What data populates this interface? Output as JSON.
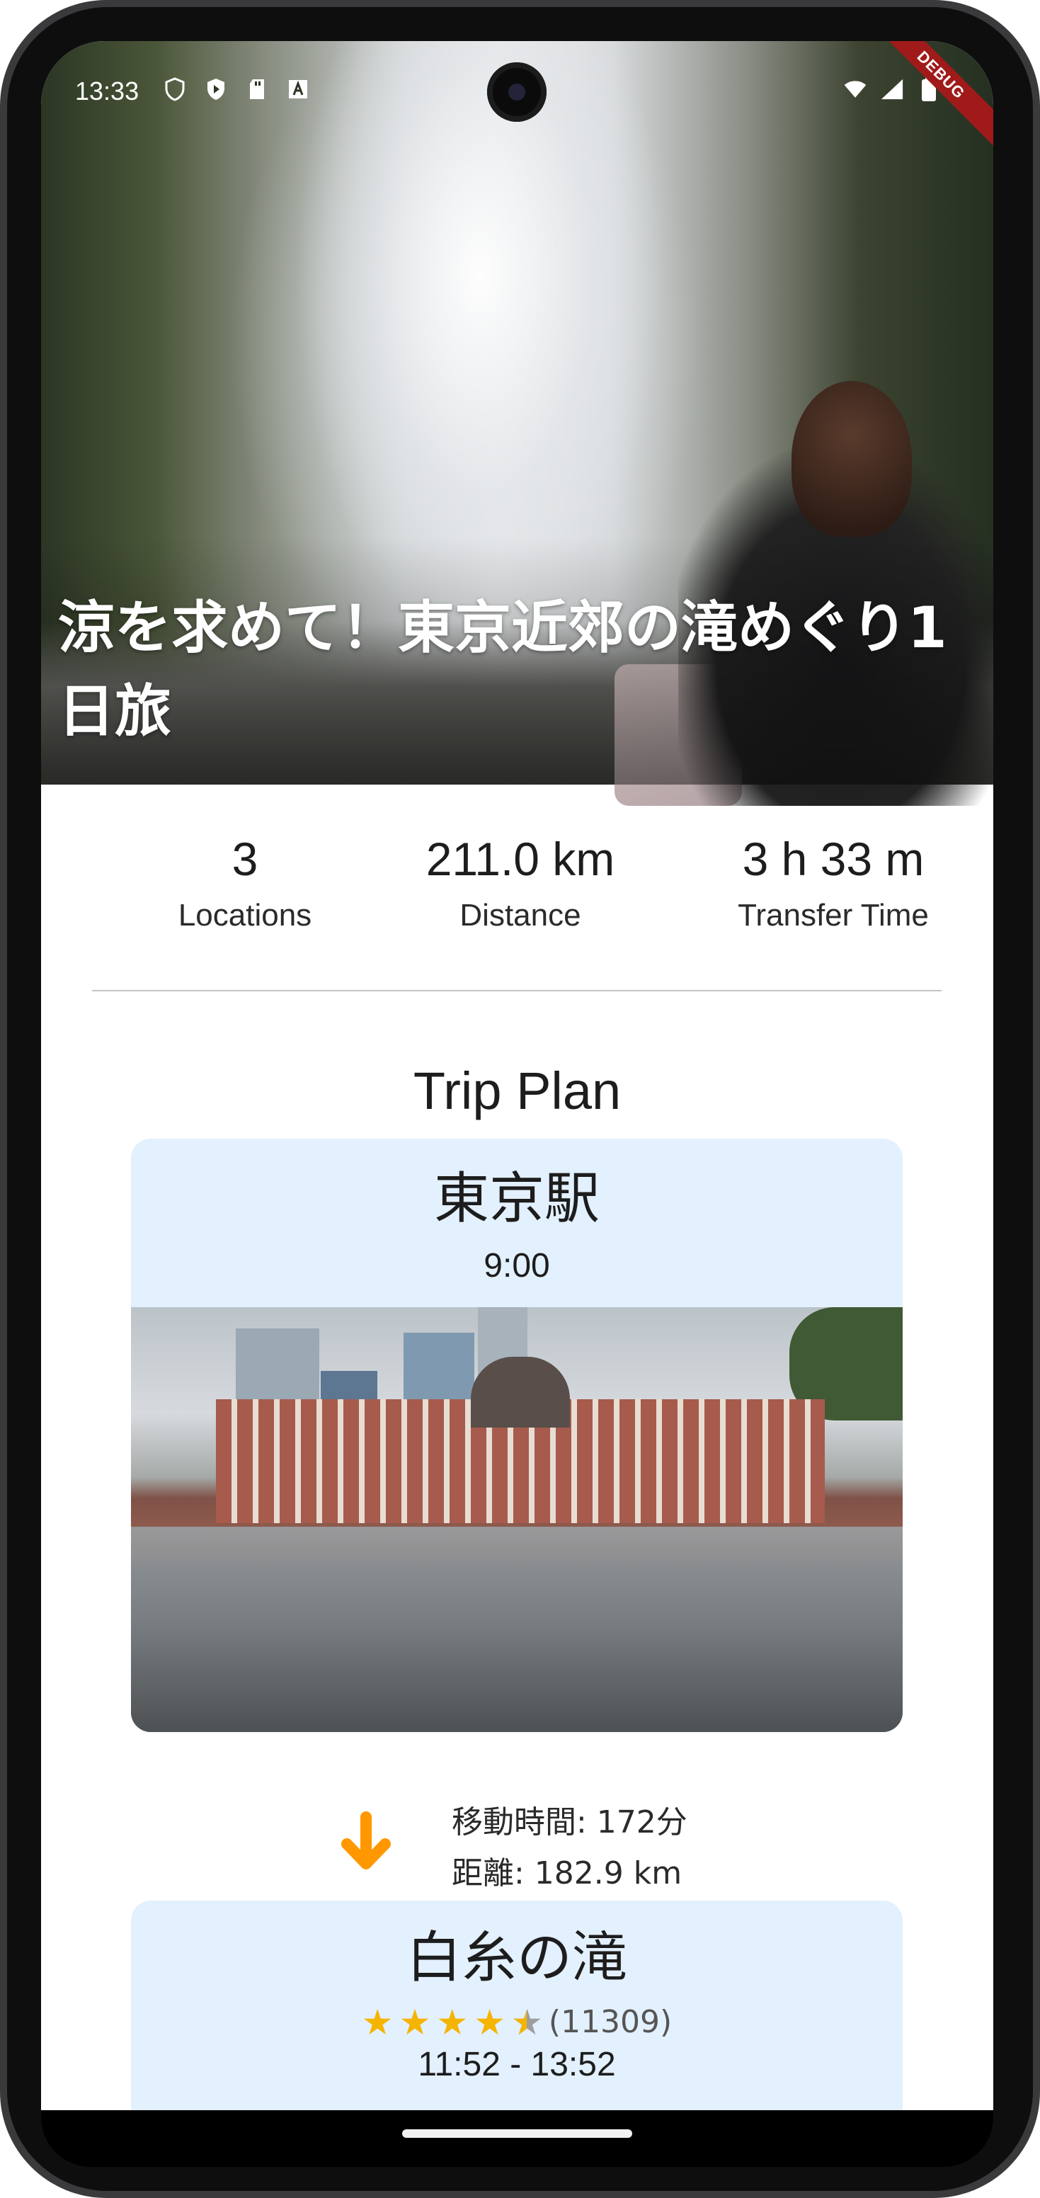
{
  "status_bar": {
    "time": "13:33",
    "debug_label": "DEBUG"
  },
  "hero": {
    "title": "涼を求めて！東京近郊の滝めぐり1日旅"
  },
  "stats": [
    {
      "value": "3",
      "label": "Locations"
    },
    {
      "value": "211.0 km",
      "label": "Distance"
    },
    {
      "value": "3 h 33 m",
      "label": "Transfer Time"
    }
  ],
  "trip_plan": {
    "title": "Trip Plan",
    "stops": [
      {
        "name": "東京駅",
        "time": "9:00"
      },
      {
        "name": "白糸の滝",
        "rating": 4.5,
        "reviews": "(11309)",
        "time": "11:52 - 13:52"
      }
    ],
    "transfers": [
      {
        "duration": "移動時間: 172分",
        "distance": "距離: 182.9 km"
      }
    ]
  },
  "colors": {
    "card_bg": "#e3f0fd",
    "arrow": "#ff9800",
    "star": "#f5b400"
  }
}
